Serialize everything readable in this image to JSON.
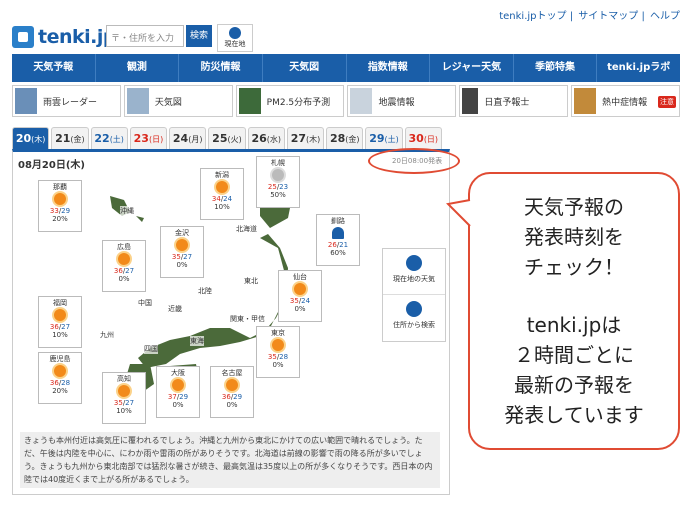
{
  "header": {
    "logo": "tenki.jp",
    "search_placeholder": "〒・住所を入力",
    "search_button": "検索",
    "location_button": "現在地",
    "top_links": [
      "tenki.jpトップ",
      "サイトマップ",
      "ヘルプ"
    ]
  },
  "nav": [
    "天気予報",
    "観測",
    "防災情報",
    "天気図",
    "指数情報",
    "レジャー天気",
    "季節特集",
    "tenki.jpラボ"
  ],
  "subnav": [
    {
      "label": "雨雲レーダー"
    },
    {
      "label": "天気図"
    },
    {
      "label": "PM2.5分布予測"
    },
    {
      "label": "地震情報"
    },
    {
      "label": "日直予報士"
    },
    {
      "label": "熱中症情報",
      "badge": "注意"
    }
  ],
  "tabs": [
    {
      "day": "20",
      "dow": "(木)",
      "kind": "active"
    },
    {
      "day": "21",
      "dow": "(金)",
      "kind": "weekday"
    },
    {
      "day": "22",
      "dow": "(土)",
      "kind": "sat"
    },
    {
      "day": "23",
      "dow": "(日)",
      "kind": "sun"
    },
    {
      "day": "24",
      "dow": "(月)",
      "kind": "weekday"
    },
    {
      "day": "25",
      "dow": "(火)",
      "kind": "weekday"
    },
    {
      "day": "26",
      "dow": "(水)",
      "kind": "weekday"
    },
    {
      "day": "27",
      "dow": "(木)",
      "kind": "weekday"
    },
    {
      "day": "28",
      "dow": "(金)",
      "kind": "weekday"
    },
    {
      "day": "29",
      "dow": "(土)",
      "kind": "sat"
    },
    {
      "day": "30",
      "dow": "(日)",
      "kind": "sun"
    }
  ],
  "map": {
    "date": "08月20日(木)",
    "issued": "20日08:00発表",
    "regions": [
      "沖縄",
      "北海道",
      "東北",
      "北陸",
      "関東・甲信",
      "東海",
      "近畿",
      "中国",
      "四国",
      "九州"
    ],
    "cities": [
      {
        "name": "那覇",
        "hi": "33",
        "lo": "29",
        "pop": "20%",
        "weather": "sunny"
      },
      {
        "name": "新潟",
        "hi": "34",
        "lo": "24",
        "pop": "10%",
        "weather": "sunny"
      },
      {
        "name": "札幌",
        "hi": "25",
        "lo": "23",
        "pop": "50%",
        "weather": "cloudy"
      },
      {
        "name": "金沢",
        "hi": "35",
        "lo": "27",
        "pop": "0%",
        "weather": "sunny"
      },
      {
        "name": "釧路",
        "hi": "26",
        "lo": "21",
        "pop": "60%",
        "weather": "rain"
      },
      {
        "name": "広島",
        "hi": "36",
        "lo": "27",
        "pop": "0%",
        "weather": "sunny"
      },
      {
        "name": "仙台",
        "hi": "35",
        "lo": "24",
        "pop": "0%",
        "weather": "sunny"
      },
      {
        "name": "福岡",
        "hi": "36",
        "lo": "27",
        "pop": "10%",
        "weather": "sunny"
      },
      {
        "name": "東京",
        "hi": "35",
        "lo": "28",
        "pop": "0%",
        "weather": "sunny"
      },
      {
        "name": "鹿児島",
        "hi": "36",
        "lo": "28",
        "pop": "20%",
        "weather": "sunny"
      },
      {
        "name": "高知",
        "hi": "35",
        "lo": "27",
        "pop": "10%",
        "weather": "sunny"
      },
      {
        "name": "大阪",
        "hi": "37",
        "lo": "29",
        "pop": "0%",
        "weather": "sunny"
      },
      {
        "name": "名古屋",
        "hi": "36",
        "lo": "29",
        "pop": "0%",
        "weather": "sunny"
      }
    ],
    "side_buttons": [
      "現在地の天気",
      "住所から検索"
    ],
    "summary": "きょうも本州付近は高気圧に覆われるでしょう。沖縄と九州から東北にかけての広い範囲で晴れるでしょう。ただ、午後は内陸を中心に、にわか雨や雷雨の所がありそうです。北海道は前線の影響で雨の降る所が多いでしょう。きょうも九州から東北南部では猛烈な暑さが続き、最高気温は35度以上の所が多くなりそうです。西日本の内陸では40度近くまで上がる所があるでしょう。"
  },
  "callout": {
    "lines_a": [
      "天気予報の",
      "発表時刻を",
      "チェック！"
    ],
    "lines_b": [
      "tenki.jpは",
      "２時間ごとに",
      "最新の予報を",
      "発表しています"
    ]
  },
  "colors": {
    "brand": "#1a5ea8",
    "accent": "#e04b33",
    "sun": "#f28a1a"
  }
}
